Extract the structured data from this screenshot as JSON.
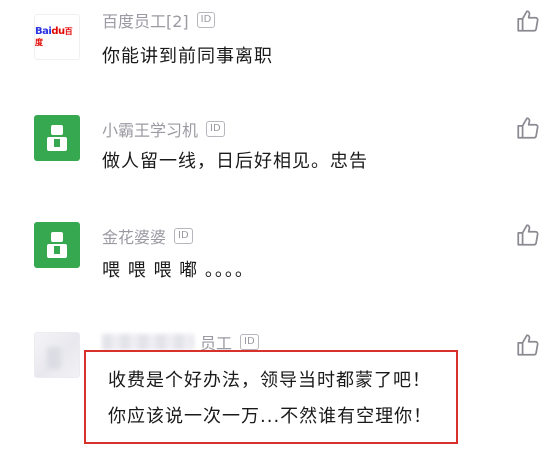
{
  "comments": [
    {
      "author": "百度员工[2]",
      "badge": "ID",
      "text": "你能讲到前同事离职",
      "avatar": "baidu"
    },
    {
      "author": "小霸王学习机",
      "badge": "ID",
      "text": "做人留一线，日后好相见。忠告",
      "avatar": "green"
    },
    {
      "author": "金花婆婆",
      "badge": "ID",
      "text": "喂 喂 喂 嘟 。。。。",
      "avatar": "green"
    },
    {
      "author_visible": "员工",
      "badge": "ID",
      "text_lines": [
        "收费是个好办法，领导当时都蒙了吧！",
        "你应该说一次一万...不然谁有空理你！"
      ],
      "avatar": "blurred"
    }
  ],
  "baidu_logo": {
    "part1": "Bai",
    "part2": "du",
    "part3": "百度"
  },
  "colors": {
    "highlight": "#d8302b",
    "avatar_green": "#35a850",
    "meta": "#9a9aa2"
  },
  "icons": {
    "like": "thumbs-up-icon",
    "avatar_person": "person-icon"
  }
}
